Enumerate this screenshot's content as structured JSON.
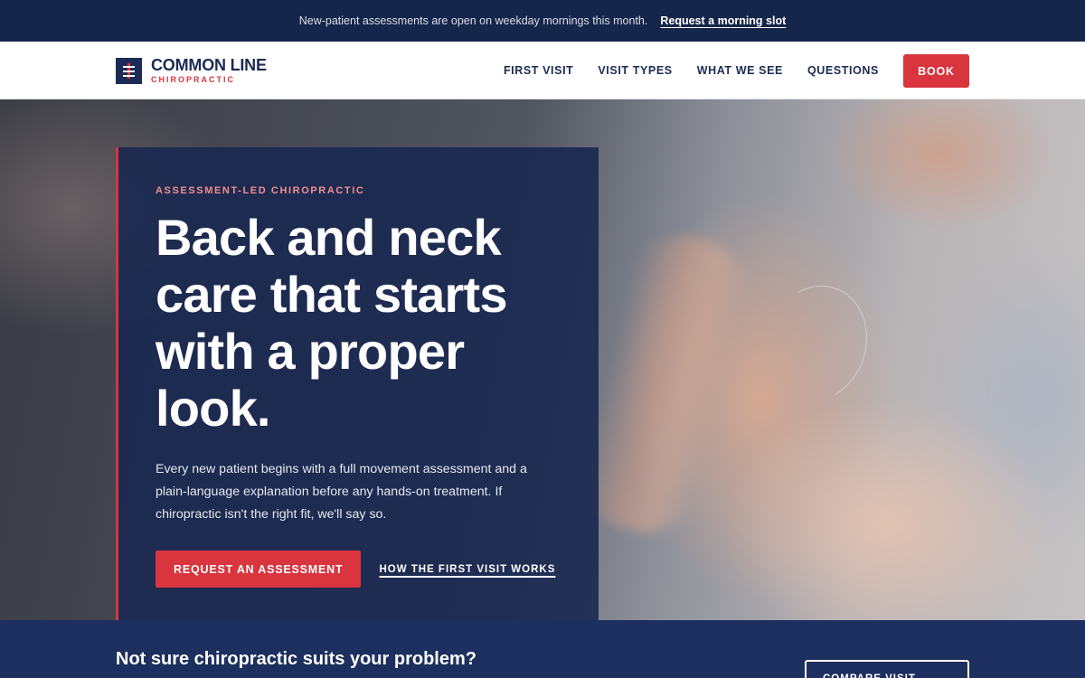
{
  "announcement": {
    "text": "New-patient assessments are open on weekday mornings this month.",
    "link_label": "Request a morning slot"
  },
  "header": {
    "brand_name": "COMMON LINE",
    "brand_subtitle": "CHIROPRACTIC",
    "nav": [
      "FIRST VISIT",
      "VISIT TYPES",
      "WHAT WE SEE",
      "QUESTIONS"
    ],
    "book_label": "BOOK"
  },
  "hero": {
    "eyebrow": "ASSESSMENT-LED CHIROPRACTIC",
    "headline": "Back and neck care that starts with a proper look.",
    "lede": "Every new patient begins with a full movement assessment and a plain-language explanation before any hands-on treatment. If chiropractic isn't the right fit, we'll say so.",
    "primary_cta": "REQUEST AN ASSESSMENT",
    "secondary_cta": "HOW THE FIRST VISIT WORKS"
  },
  "band": {
    "title": "Not sure chiropractic suits your problem?",
    "button_label": "COMPARE VISIT"
  },
  "colors": {
    "navy": "#1c2b55",
    "accent_red": "#d8353f",
    "announcement_bg": "#16264a",
    "band_bg": "#1c2f5e"
  }
}
